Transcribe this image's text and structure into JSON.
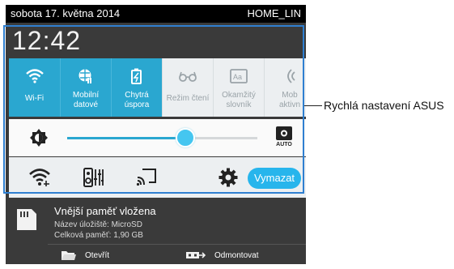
{
  "status_bar": {
    "date": "sobota 17. května 2014",
    "network": "HOME_LIN"
  },
  "clock": "12:42",
  "quick_settings": {
    "tiles": [
      {
        "label": "Wi-Fi",
        "icon": "wifi-icon",
        "active": true
      },
      {
        "label": "Mobilní\ndatové",
        "icon": "mobile-data-icon",
        "active": true
      },
      {
        "label": "Chytrá\núspora",
        "icon": "battery-saver-icon",
        "active": true
      },
      {
        "label": "Režim čtení",
        "icon": "reading-mode-icon",
        "active": false
      },
      {
        "label": "Okamžitý\nslovník",
        "icon": "dictionary-icon",
        "active": false
      },
      {
        "label": "Mob\naktivn",
        "icon": "mobile-hotspot-icon",
        "active": false
      }
    ],
    "brightness_level": 0.62,
    "auto_brightness_label": "AUTO",
    "clear_label": "Vymazat"
  },
  "notification": {
    "title": "Vnější paměť vložena",
    "storage_name": "Název úložiště: MicroSD",
    "total_memory": "Celková paměť: 1,90 GB",
    "open_label": "Otevřít",
    "unmount_label": "Odmontovat"
  },
  "callout": {
    "label": "Rychlá nastavení ASUS"
  },
  "colors": {
    "accent": "#2aa7d0",
    "button": "#27b5ec",
    "dark": "#3a3a3a",
    "callout_frame": "#2f7fd0"
  }
}
